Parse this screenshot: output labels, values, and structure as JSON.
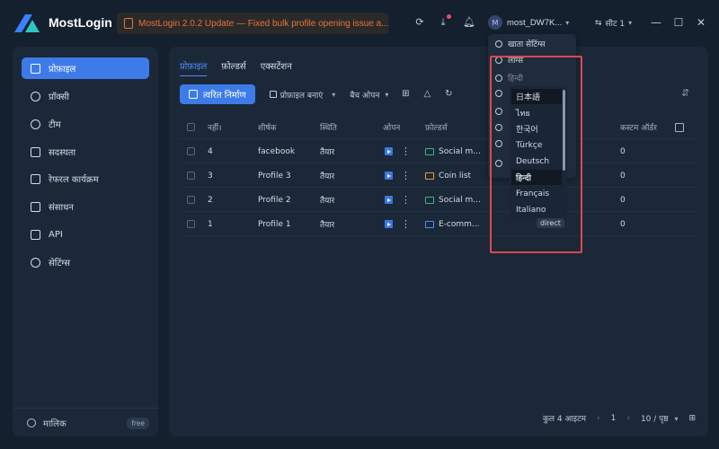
{
  "app": {
    "title": "MostLogin",
    "update_banner": "MostLogin 2.0.2 Update — Fixed bulk profile opening issue a...",
    "user": {
      "initial": "M",
      "name": "most_DW7K..."
    },
    "seat_label": "सीट 1"
  },
  "sidebar": {
    "items": [
      {
        "label": "प्रोफ़ाइल",
        "icon": "profile-icon",
        "active": true
      },
      {
        "label": "प्रॉक्सी",
        "icon": "proxy-icon"
      },
      {
        "label": "टीम",
        "icon": "team-icon"
      },
      {
        "label": "सदस्यता",
        "icon": "subscription-icon"
      },
      {
        "label": "रेफरल कार्यक्रम",
        "icon": "referral-icon"
      },
      {
        "label": "संसाधन",
        "icon": "resources-icon"
      },
      {
        "label": "API",
        "icon": "api-icon"
      },
      {
        "label": "सेटिंग्स",
        "icon": "settings-icon"
      }
    ],
    "footer": {
      "owner_label": "मालिक",
      "plan_badge": "free"
    }
  },
  "main": {
    "tabs": [
      "प्रोफ़ाइल",
      "फ़ोल्डर्स",
      "एक्सटेंशन"
    ],
    "toolbar": {
      "quick_create": "त्वरित निर्माण",
      "create_profile": "प्रोफ़ाइल बनाएं",
      "batch_open": "बैच ओपन"
    },
    "table": {
      "headers": [
        "नहीं।",
        "शीर्षक",
        "स्थिति",
        "ओपन",
        "फ़ोल्डर्स",
        "कस्टम ऑर्डर"
      ],
      "rows": [
        {
          "no": "4",
          "title": "facebook",
          "status": "तैयार",
          "folder": "Social m...",
          "folder_color": "#3fb57a",
          "order": "0"
        },
        {
          "no": "3",
          "title": "Profile 3",
          "status": "तैयार",
          "folder": "Coin list",
          "folder_color": "#e59b3b",
          "order": "0"
        },
        {
          "no": "2",
          "title": "Profile 2",
          "status": "तैयार",
          "folder": "Social m...",
          "folder_color": "#3fb57a",
          "order": "0"
        },
        {
          "no": "1",
          "title": "Profile 1",
          "status": "तैयार",
          "folder": "E-comm...",
          "folder_color": "#4e8ef7",
          "order": "0"
        }
      ]
    },
    "pagination": {
      "total": "कुल 4 आइटम",
      "page": "1",
      "page_size": "10 / पृष्ठ"
    }
  },
  "account_menu": {
    "items": [
      {
        "label": "खाता सेटिंग्स",
        "icon": "account-settings-icon"
      },
      {
        "label": "लॉग्स",
        "icon": "logs-icon"
      },
      {
        "label": "हिन्दी",
        "icon": "language-icon"
      }
    ],
    "languages": [
      "日本語",
      "ไทย",
      "한국어",
      "Türkçe",
      "Deutsch",
      "हिन्दी",
      "Français",
      "Italiano"
    ],
    "selected_language": "हिन्दी",
    "proxy_chip": "direct"
  },
  "colors": {
    "accent": "#3d7be8",
    "warning": "#e8733a",
    "highlight_box": "#e0474c"
  }
}
